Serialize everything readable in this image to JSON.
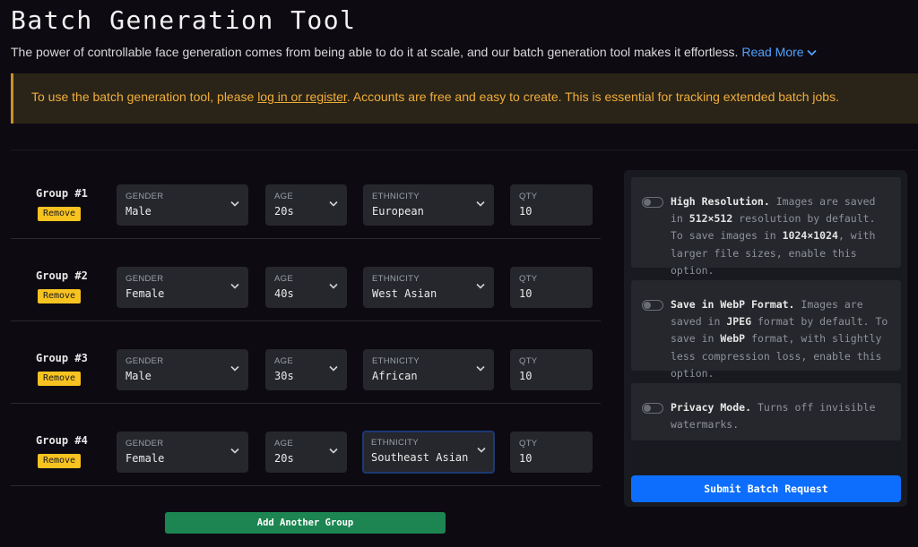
{
  "title": "Batch Generation Tool",
  "subtitle": {
    "text": "The power of controllable face generation comes from being able to do it at scale, and our batch generation tool makes it effortless.",
    "read_more": "Read More"
  },
  "notice": {
    "prefix": "To use the batch generation tool, please ",
    "link": "log in or register",
    "suffix": ". Accounts are free and easy to create. This is essential for tracking extended batch jobs."
  },
  "field_labels": {
    "gender": "GENDER",
    "age": "AGE",
    "ethnicity": "ETHNICITY",
    "qty": "QTY"
  },
  "remove_label": "Remove",
  "groups": [
    {
      "label": "Group #1",
      "gender": "Male",
      "age": "20s",
      "ethnicity": "European",
      "qty": "10"
    },
    {
      "label": "Group #2",
      "gender": "Female",
      "age": "40s",
      "ethnicity": "West Asian",
      "qty": "10"
    },
    {
      "label": "Group #3",
      "gender": "Male",
      "age": "30s",
      "ethnicity": "African",
      "qty": "10"
    },
    {
      "label": "Group #4",
      "gender": "Female",
      "age": "20s",
      "ethnicity": "Southeast Asian",
      "qty": "10"
    }
  ],
  "add_group_label": "Add Another Group",
  "options": {
    "high_res": {
      "title": "High Resolution.",
      "t1": " Images are saved in ",
      "v1": "512×512",
      "t2": " resolution by default. To save images in ",
      "v2": "1024×1024",
      "t3": ", with larger file sizes, enable this option."
    },
    "webp": {
      "title": "Save in WebP Format.",
      "t1": " Images are saved in ",
      "v1": "JPEG",
      "t2": " format by default. To save in ",
      "v2": "WebP",
      "t3": " format, with slightly less compression loss, enable this option."
    },
    "privacy": {
      "title": "Privacy Mode.",
      "t1": " Turns off invisible watermarks."
    }
  },
  "submit_label": "Submit Batch Request",
  "colors": {
    "accent_blue": "#0d6efd",
    "remove_yellow": "#f7c321",
    "add_green": "#1c8551",
    "notice_amber": "#f0ad3a"
  }
}
